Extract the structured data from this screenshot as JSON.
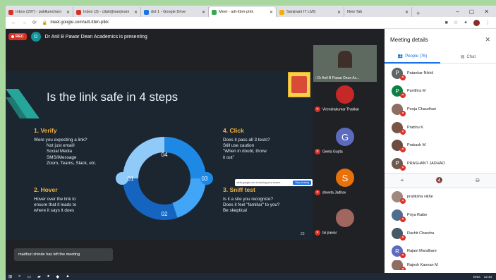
{
  "browser": {
    "tabs": [
      {
        "label": "Inbox (297) - patilkanchani",
        "color": "#d93025"
      },
      {
        "label": "Inbox (3) - ctlpit@sanjivani",
        "color": "#d93025"
      },
      {
        "label": "dot 1 - Google Drive",
        "color": "#1a73e8"
      },
      {
        "label": "Meet - adt-ttbm-ptkk",
        "color": "#34a853"
      },
      {
        "label": "Sanjivani IT LMS",
        "color": "#f9ab00"
      },
      {
        "label": "New Tab",
        "color": "#9aa0a6"
      }
    ],
    "new_tab": "+",
    "win_controls": [
      "–",
      "▢",
      "✕"
    ],
    "url": "meet.google.com/adt-ttbm-ptkk",
    "nav": [
      "←",
      "→",
      "⟳"
    ]
  },
  "meet": {
    "rec_label": "REC",
    "presenter_initial": "D",
    "presenting_text": "Dr Anil B Pawar Dean Academics is presenting",
    "left_toast": "madhuri shinde has left the meeting"
  },
  "slide": {
    "title": "Is the link safe in 4 steps",
    "step1_title": "1. Verify",
    "step1_lines": [
      "Were you expecting a link?",
      "Not just email!",
      "Social Media",
      "SMS/iMessage",
      "Zoom, Teams, Slack, etc."
    ],
    "step2_title": "2. Hover",
    "step2_lines": [
      "Hover over the link to",
      "ensure that it leads to",
      "where it says it does"
    ],
    "step3_title": "3. Sniff test",
    "step3_lines": [
      "Is it a site you recognize?",
      "Does it feel \"familiar\" to you?",
      "Be skeptical"
    ],
    "step4_title": "4. Click",
    "step4_lines": [
      "Does it pass all 3 tests?",
      "Still use caution",
      "\"When in doubt, throw",
      "it out\""
    ],
    "ring_labels": [
      "01",
      "02",
      "03",
      "04"
    ],
    "share_toast": "meet.google.com is sharing your screen.",
    "share_stop": "Stop sharing",
    "slide_number": "23"
  },
  "tiles": [
    {
      "name": "Dr Anil B Pawar Dean Ac..."
    },
    {
      "name": "Virendrakumar Thakkar"
    },
    {
      "name": "Geeta Gupta",
      "initial": "G",
      "color": "#5c6bc0"
    },
    {
      "name": "shweta Jadhav",
      "initial": "S",
      "color": "#e8710a"
    },
    {
      "name": "tai pawar"
    }
  ],
  "panel": {
    "title": "Meeting details",
    "close": "✕",
    "people_label": "People (76)",
    "chat_label": "Chat",
    "participants": [
      {
        "name": "Patankar Nikhil",
        "initial": "P",
        "color": "#5f6368"
      },
      {
        "name": "Pavithra M",
        "initial": "P",
        "color": "#0b8043"
      },
      {
        "name": "Pooja Chaudhari",
        "initial": "",
        "color": "#8d6e63"
      },
      {
        "name": "Prabhu K",
        "initial": "",
        "color": "#795548"
      },
      {
        "name": "Prakash M",
        "initial": "",
        "color": "#6d4c41"
      },
      {
        "name": "PRASHANT JADHAO",
        "initial": "P",
        "color": "#6d5a4f"
      },
      {
        "name": "pratiksha vikhe",
        "initial": "",
        "color": "#a1887f"
      },
      {
        "name": "Priya Raibe",
        "initial": "",
        "color": "#4e6e8e"
      },
      {
        "name": "Rachit Chandra",
        "initial": "",
        "color": "#455a64"
      },
      {
        "name": "Rajani Mandhare",
        "initial": "R",
        "color": "#5c6bc0"
      },
      {
        "name": "Rajesh Kannan M",
        "initial": "",
        "color": "#8d6e63"
      }
    ],
    "controls": [
      "⌖",
      "🔇",
      "⊖"
    ]
  },
  "taskbar": {
    "clock": "12:43",
    "lang": "ENG"
  }
}
